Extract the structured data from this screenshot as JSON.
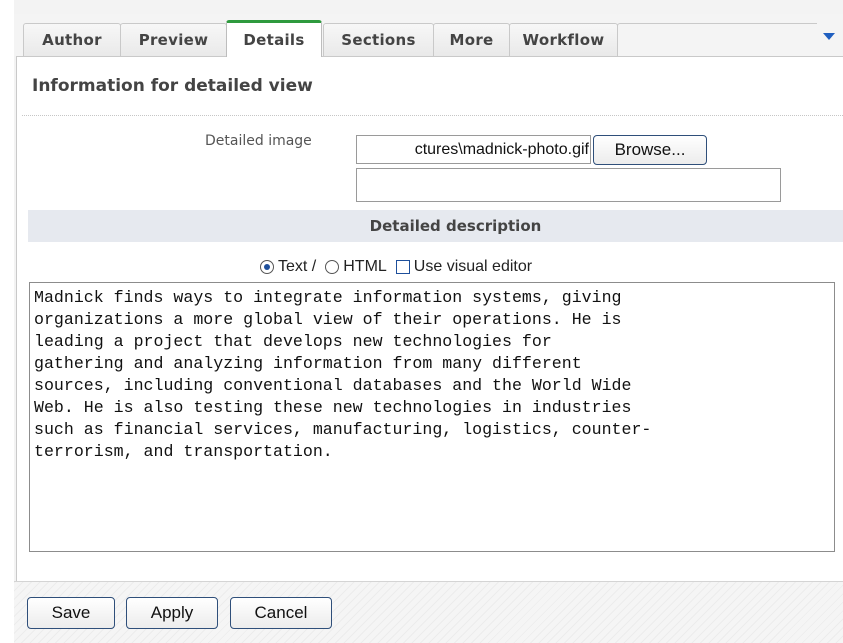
{
  "tabs": [
    {
      "label": "Author"
    },
    {
      "label": "Preview"
    },
    {
      "label": "Details"
    },
    {
      "label": "Sections"
    },
    {
      "label": "More"
    },
    {
      "label": "Workflow"
    }
  ],
  "active_tab": "Details",
  "panel": {
    "title": "Information for detailed view"
  },
  "detailed_image": {
    "label": "Detailed image",
    "file_value": "ctures\\madnick-photo.gif",
    "browse_label": "Browse...",
    "second_field_value": ""
  },
  "description": {
    "header": "Detailed description",
    "format_text_label": "Text /",
    "format_html_label": "HTML",
    "visual_editor_label": "Use visual editor",
    "selected_format": "Text",
    "visual_editor_checked": false,
    "body": "Madnick finds ways to integrate information systems, giving\norganizations a more global view of their operations. He is\nleading a project that develops new technologies for\ngathering and analyzing information from many different\nsources, including conventional databases and the World Wide\nWeb. He is also testing these new technologies in industries\nsuch as financial services, manufacturing, logistics, counter-\nterrorism, and transportation."
  },
  "footer": {
    "save_label": "Save",
    "apply_label": "Apply",
    "cancel_label": "Cancel"
  },
  "icons": {
    "tab_menu": "triangle-down-icon"
  },
  "colors": {
    "active_tab_accent": "#2e9a3e",
    "section_header_bg": "#e6e9ef",
    "menu_arrow": "#1f5fc0"
  }
}
